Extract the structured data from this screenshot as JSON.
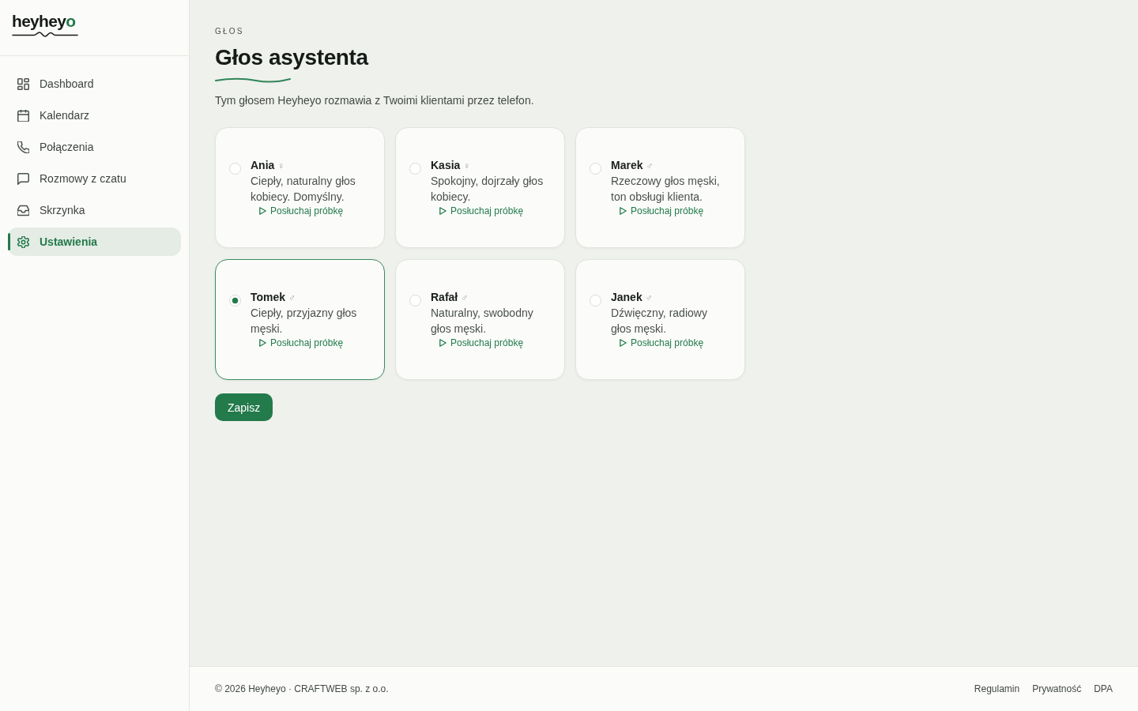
{
  "sidebar": {
    "logo": {
      "text": "heyhey",
      "accent": "o"
    },
    "items": [
      {
        "label": "Dashboard",
        "selected": false
      },
      {
        "label": "Kalendarz",
        "selected": false
      },
      {
        "label": "Połączenia",
        "selected": false
      },
      {
        "label": "Rozmowy z czatu",
        "selected": false
      },
      {
        "label": "Skrzynka",
        "selected": false
      },
      {
        "label": "Ustawienia",
        "selected": true
      }
    ]
  },
  "header": {
    "eyebrow": "GŁOS",
    "title": "Głos asystenta",
    "description": "Tym głosem Heyheyo rozmawia z Twoimi klientami przez telefon."
  },
  "voices": [
    {
      "name": "Ania",
      "gender_symbol": "♀",
      "description": "Ciepły, naturalny głos kobiecy. Domyślny.",
      "sample_link": "Posłuchaj próbkę",
      "selected": false
    },
    {
      "name": "Kasia",
      "gender_symbol": "♀",
      "description": "Spokojny, dojrzały głos kobiecy.",
      "sample_link": "Posłuchaj próbkę",
      "selected": false
    },
    {
      "name": "Marek",
      "gender_symbol": "♂",
      "description": "Rzeczowy głos męski, ton obsługi klienta.",
      "sample_link": "Posłuchaj próbkę",
      "selected": false
    },
    {
      "name": "Tomek",
      "gender_symbol": "♂",
      "description": "Ciepły, przyjazny głos męski.",
      "sample_link": "Posłuchaj próbkę",
      "selected": true
    },
    {
      "name": "Rafał",
      "gender_symbol": "♂",
      "description": "Naturalny, swobodny głos męski.",
      "sample_link": "Posłuchaj próbkę",
      "selected": false
    },
    {
      "name": "Janek",
      "gender_symbol": "♂",
      "description": "Dźwięczny, radiowy głos męski.",
      "sample_link": "Posłuchaj próbkę",
      "selected": false
    }
  ],
  "save_button": "Zapisz",
  "footer": {
    "copyright": "© 2026 Heyheyo · CRAFTWEB sp. z o.o.",
    "links": [
      "Regulamin",
      "Prywatność",
      "DPA"
    ]
  }
}
